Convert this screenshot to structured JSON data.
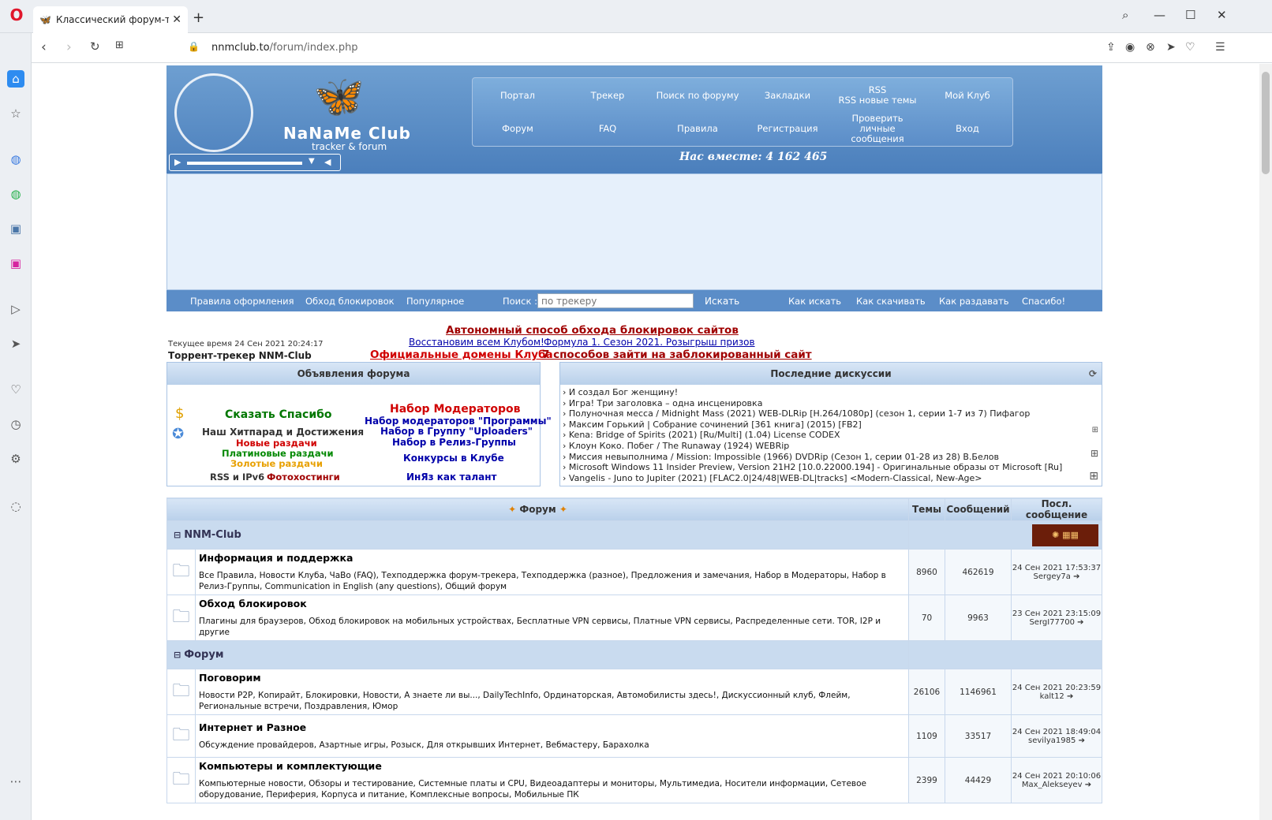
{
  "browser": {
    "tab_title": "Классический форум-тре",
    "url_host": "nnmclub.to",
    "url_path": "/forum/index.php"
  },
  "header": {
    "logo_title": "NaNaMe Club",
    "logo_subtitle": "tracker & forum",
    "together": "Нас вместе: 4 162 465",
    "menu": [
      "Портал",
      "Трекер",
      "Поиск по форуму",
      "Закладки",
      "RSS\nRSS новые темы",
      "Мой Клуб",
      "Форум",
      "FAQ",
      "Правила",
      "Регистрация",
      "Проверить личные сообщения",
      "Вход"
    ]
  },
  "subnav": {
    "rules": "Правила оформления",
    "bypass": "Обход блокировок",
    "popular": "Популярное",
    "search_label": "Поиск :",
    "search_placeholder": "по трекеру",
    "search_button": "Искать",
    "how_search": "Как искать",
    "how_download": "Как скачивать",
    "how_seed": "Как раздавать",
    "thanks": "Спасибо!"
  },
  "announcements": {
    "current_time": "Текущее время 24 Сен 2021 20:24:17",
    "tracker_name": "Торрент-трекер NNM-Club",
    "line1": "Автономный способ обхода блокировок сайтов",
    "line2a": "Восстановим всем Клубом!",
    "line2b": "Формула 1. Сезон 2021. Розыгрыш призов",
    "line3a": "Официальные домены Клуба",
    "line3b": "7 способов зайти на заблокированный сайт"
  },
  "forum_ann": {
    "title": "Объявления форума",
    "say_thanks": "Сказать Спасибо",
    "hitparade": "Наш Хитпарад и Достижения",
    "new_releases": "Новые раздачи",
    "platinum": "Платиновые раздачи",
    "gold": "Золотые раздачи",
    "rss": "RSS и IPv6",
    "photohost": "Фотохостинги",
    "mod_recruit": "Набор Модераторов",
    "mod_programs": "Набор модераторов \"Программы\"",
    "uploaders": "Набор в Группу \"Uploaders\"",
    "release_group": "Набор в Релиз-Группы",
    "contests": "Конкурсы в Клубе",
    "foreign": "ИнЯз как талант"
  },
  "discussions": {
    "title": "Последние дискуссии",
    "items": [
      "› И создал Бог женщину!",
      "› Игра! Три заголовка – одна инсценировка",
      "› Полуночная месса / Midnight Mass (2021) WEB-DLRip [H.264/1080p] (сезон 1, серии 1-7 из 7) Пифагор",
      "› Максим Горький | Собрание сочинений [361 книга] (2015) [FB2]",
      "› Kena: Bridge of Spirits (2021) [Ru/Multi] (1.04) License CODEX",
      "› Клоун Коко. Побег / The Runaway (1924) WEBRip",
      "› Миссия невыполнима / Mission: Impossible (1966) DVDRip (Сезон 1, серии 01-28 из 28) В.Белов",
      "› Microsoft Windows 11 Insider Preview, Version 21H2 [10.0.22000.194] - Оригинальные образы от Microsoft [Ru]",
      "› Vangelis - Juno to Jupiter (2021) [FLAC2.0|24/48|WEB-DL|tracks] <Modern-Classical, New-Age>"
    ]
  },
  "forum_table": {
    "col_forum": "Форум",
    "col_topics": "Темы",
    "col_posts": "Сообщений",
    "col_last": "Посл. сообщение",
    "categories": [
      {
        "name": "NNM-Club",
        "forums": [
          {
            "name": "Информация и поддержка",
            "subs": "Все Правила, Новости Клуба, ЧаВо (FAQ), Техподдержка форум-трекера, Техподдержка (разное), Предложения и замечания, Набор в Модераторы, Набор в Релиз-Группы, Communication in English (any questions), Общий форум",
            "topics": "8960",
            "posts": "462619",
            "last_date": "24 Сен 2021 17:53:37",
            "last_user": "Sergey7a"
          },
          {
            "name": "Обход блокировок",
            "subs": "Плагины для браузеров, Обход блокировок на мобильных устройствах, Бесплатные VPN сервисы, Платные VPN сервисы, Распределенные сети. TOR, I2P и другие",
            "topics": "70",
            "posts": "9963",
            "last_date": "23 Сен 2021 23:15:09",
            "last_user": "SergI77700"
          }
        ]
      },
      {
        "name": "Форум",
        "forums": [
          {
            "name": "Поговорим",
            "subs": "Новости P2P, Копирайт, Блокировки, Новости, А знаете ли вы..., DailyTechInfo, Ординаторская, Автомобилисты здесь!, Дискуссионный клуб, Флейм, Региональные встречи, Поздравления, Юмор",
            "topics": "26106",
            "posts": "1146961",
            "last_date": "24 Сен 2021 20:23:59",
            "last_user": "kalt12"
          },
          {
            "name": "Интернет и Разное",
            "subs": "Обсуждение провайдеров, Азартные игры, Розыск, Для открывших Интернет, Вебмастеру, Барахолка",
            "topics": "1109",
            "posts": "33517",
            "last_date": "24 Сен 2021 18:49:04",
            "last_user": "sevilya1985"
          },
          {
            "name": "Компьютеры и комплектующие",
            "subs": "Компьютерные новости, Обзоры и тестирование, Системные платы и CPU, Видеоадаптеры и мониторы, Мультимедиа, Носители информации, Сетевое оборудование, Периферия, Корпуса и питание, Комплексные вопросы, Мобильные ПК",
            "topics": "2399",
            "posts": "44429",
            "last_date": "24 Сен 2021 20:10:06",
            "last_user": "Max_Alekseyev"
          }
        ]
      }
    ]
  }
}
